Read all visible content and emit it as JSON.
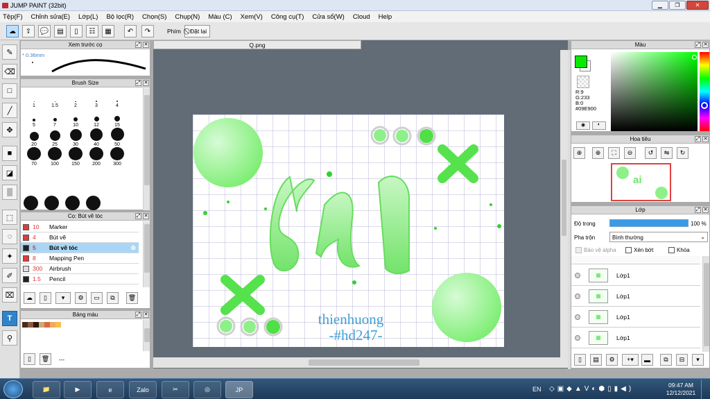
{
  "window": {
    "title": "JUMP PAINT (32bit)"
  },
  "menu": [
    "Tệp(F)",
    "Chỉnh sửa(E)",
    "Lớp(L)",
    "Bộ lọc(R)",
    "Chọn(S)",
    "Chụp(N)",
    "Màu (C)",
    "Xem(V)",
    "Công cụ(T)",
    "Cửa sổ(W)",
    "Cloud",
    "Help"
  ],
  "toolbar": {
    "label": "Phím",
    "reset": "Đặt lại"
  },
  "panels": {
    "preview": {
      "title": "Xem trước cọ",
      "size": "0.36mm"
    },
    "brushsize": {
      "title": "Brush Size",
      "sizes": [
        "1",
        "1.5",
        "2",
        "3",
        "4",
        "5",
        "7",
        "10",
        "12",
        "15",
        "20",
        "25",
        "30",
        "40",
        "50",
        "70",
        "100",
        "150",
        "200",
        "300"
      ]
    },
    "brushes": {
      "title": "Cọ: Bút vẽ tóc",
      "items": [
        {
          "num": "10",
          "name": "Marker",
          "color": "#e03a3a"
        },
        {
          "num": "4",
          "name": "Bút vẽ",
          "color": "#e03a3a"
        },
        {
          "num": "5",
          "name": "Bút vẽ tóc",
          "color": "#222222"
        },
        {
          "num": "8",
          "name": "Mapping Pen",
          "color": "#e03a3a"
        },
        {
          "num": "300",
          "name": "Airbrush",
          "color": "#dddddd"
        },
        {
          "num": "1.5",
          "name": "Pencil",
          "color": "#222222"
        }
      ]
    },
    "palette": {
      "title": "Bảng màu",
      "more": "---",
      "swatches": [
        "#4a2a1c",
        "#8a5a40",
        "#2c1a12",
        "#d1a57a",
        "#d46a3e",
        "#f2a860",
        "#f5c04e"
      ]
    }
  },
  "document": {
    "tab": "Q.png",
    "signature1": "thienhuong",
    "signature2": "-#hd247-"
  },
  "color": {
    "title": "Màu",
    "r": "R:9",
    "g": "G:233",
    "b": "B:0",
    "hex": "#09E900",
    "primary": "#09e900"
  },
  "navigator": {
    "title": "Hoa tiêu"
  },
  "layers": {
    "title": "Lớp",
    "opacity_label": "Độ trong",
    "opacity_value": "100 %",
    "blend_label": "Pha trộn",
    "blend_value": "Bình thường",
    "protect_alpha": "Bảo vệ alpha",
    "clip": "Xén bớt",
    "lock": "Khóa",
    "items": [
      {
        "name": "Lớp1"
      },
      {
        "name": "Lớp1"
      },
      {
        "name": "Lớp1"
      },
      {
        "name": "Lớp1"
      }
    ]
  },
  "taskbar": {
    "lang": "EN",
    "time": "09:47 AM",
    "date": "12/12/2021"
  }
}
